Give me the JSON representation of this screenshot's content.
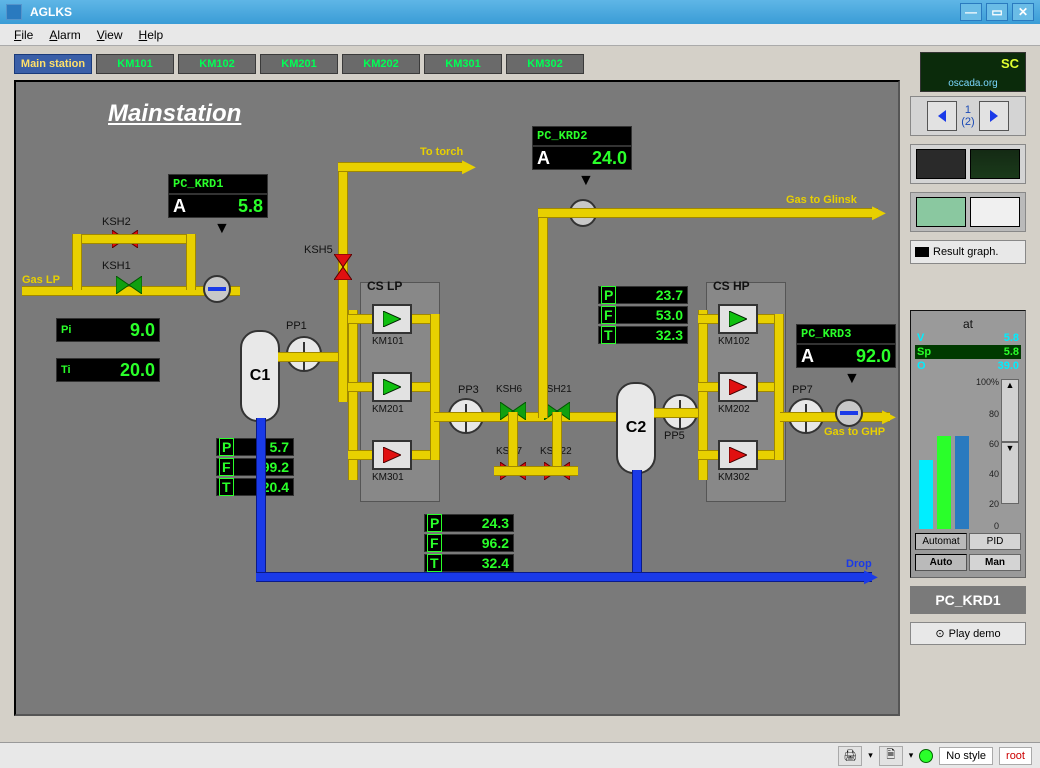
{
  "window": {
    "title": "AGLKS"
  },
  "menu": {
    "file": "File",
    "alarm": "Alarm",
    "view": "View",
    "help": "Help"
  },
  "tabs": [
    "Main station",
    "KM101",
    "KM102",
    "KM201",
    "KM202",
    "KM301",
    "KM302"
  ],
  "logo_text": "oscada.org",
  "nav_count": {
    "top": "1",
    "bottom": "(2)"
  },
  "result_btn": "Result graph.",
  "control": {
    "title": "at",
    "v": {
      "label": "V",
      "value": "5.8"
    },
    "sp": {
      "label": "Sp",
      "value": "5.8"
    },
    "o": {
      "label": "O",
      "value": "39.0"
    },
    "scale_top": "100%",
    "scale_80": "80",
    "scale_60": "60",
    "scale_40": "40",
    "scale_20": "20",
    "scale_0": "0",
    "mode_a": "Automat",
    "mode_b": "PID",
    "auto": "Auto",
    "man": "Man",
    "pc_label": "PC_KRD1"
  },
  "play": "Play demo",
  "status": {
    "nostyle": "No style",
    "user": "root"
  },
  "diagram": {
    "title": "Mainstation",
    "gas_lp": "Gas LP",
    "to_torch": "To torch",
    "gas_glinsk": "Gas to Glinsk",
    "gas_ghp": "Gas to GHP",
    "drop": "Drop",
    "pi_val": "9.0",
    "pi_lab": "Pi",
    "ti_val": "20.0",
    "ti_lab": "Ti",
    "ksh1": "KSH1",
    "ksh2": "KSH2",
    "ksh5": "KSH5",
    "ksh6": "KSH6",
    "ksh7": "KSH7",
    "ksh21": "KSH21",
    "ksh22": "KSH22",
    "pp1": "PP1",
    "pp3": "PP3",
    "pp5": "PP5",
    "pp7": "PP7",
    "c1": "C1",
    "c2": "C2",
    "cs_lp": "CS LP",
    "cs_hp": "CS HP",
    "km101": "KM101",
    "km201": "KM201",
    "km301": "KM301",
    "km102": "KM102",
    "km202": "KM202",
    "km302": "KM302",
    "krd1": {
      "name": "PC_KRD1",
      "a": "A",
      "val": "5.8"
    },
    "krd2": {
      "name": "PC_KRD2",
      "a": "A",
      "val": "24.0"
    },
    "krd3": {
      "name": "PC_KRD3",
      "a": "A",
      "val": "92.0"
    },
    "c1_p": "5.7",
    "c1_f": "99.2",
    "c1_t": "20.4",
    "pp3_p": "24.3",
    "pp3_f": "96.2",
    "pp3_t": "32.4",
    "c2_p": "23.7",
    "c2_f": "53.0",
    "c2_t": "32.3",
    "lab_p": "P",
    "lab_f": "F",
    "lab_t": "T"
  }
}
